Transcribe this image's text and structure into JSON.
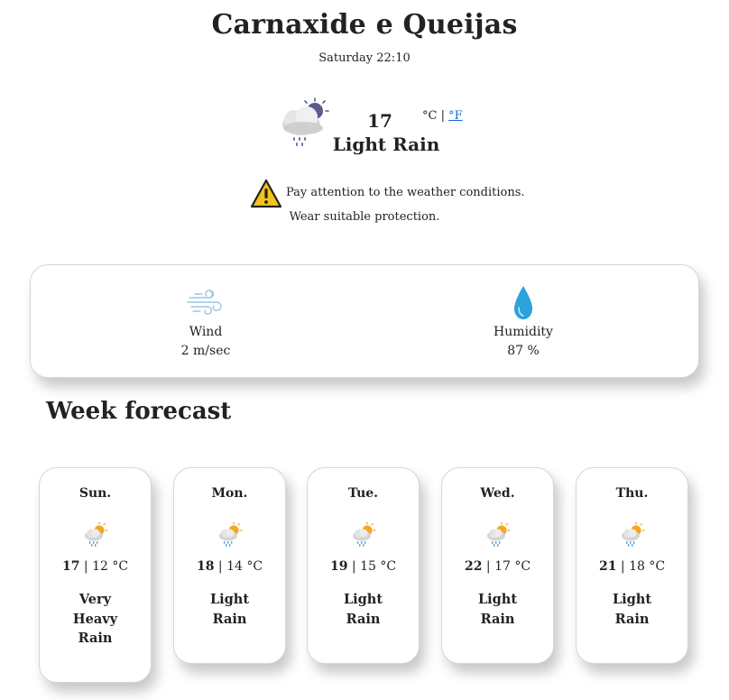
{
  "location": {
    "city": "Carnaxide e Queijas",
    "datetime": "Saturday 22:10"
  },
  "current": {
    "icon": "cloud-rain-night-icon",
    "temperature": "17",
    "unit_c": "°C",
    "unit_separator": "|",
    "unit_f": "°F",
    "condition": "Light Rain",
    "warning_icon": "warning-triangle-icon",
    "warning_line1": "Pay attention to the weather conditions.",
    "warning_line2": "Wear suitable protection."
  },
  "stats": {
    "wind": {
      "icon": "wind-icon",
      "label": "Wind",
      "value": "2 m/sec"
    },
    "humidity": {
      "icon": "water-drop-icon",
      "label": "Humidity",
      "value": "87 %"
    }
  },
  "week": {
    "title": "Week forecast",
    "days": [
      {
        "name": "Sun.",
        "icon": "sun-cloud-rain-icon",
        "high": "17",
        "separator": "|",
        "low": "12 °C",
        "condition": "Very Heavy Rain"
      },
      {
        "name": "Mon.",
        "icon": "sun-cloud-rain-icon",
        "high": "18",
        "separator": "|",
        "low": "14 °C",
        "condition": "Light Rain"
      },
      {
        "name": "Tue.",
        "icon": "sun-cloud-rain-icon",
        "high": "19",
        "separator": "|",
        "low": "15 °C",
        "condition": "Light Rain"
      },
      {
        "name": "Wed.",
        "icon": "sun-cloud-rain-icon",
        "high": "22",
        "separator": "|",
        "low": "17 °C",
        "condition": "Light Rain"
      },
      {
        "name": "Thu.",
        "icon": "sun-cloud-rain-icon",
        "high": "21",
        "separator": "|",
        "low": "18 °C",
        "condition": "Light Rain"
      }
    ]
  },
  "colors": {
    "text": "#222222",
    "link": "#1a66d6",
    "card_border": "#d6d6d6",
    "moon": "#5a5a8c",
    "warning_yellow": "#f4c21c",
    "drop_blue": "#2aa2dc",
    "wind_blue": "#9cc6e4",
    "sun_orange": "#f5a623"
  }
}
